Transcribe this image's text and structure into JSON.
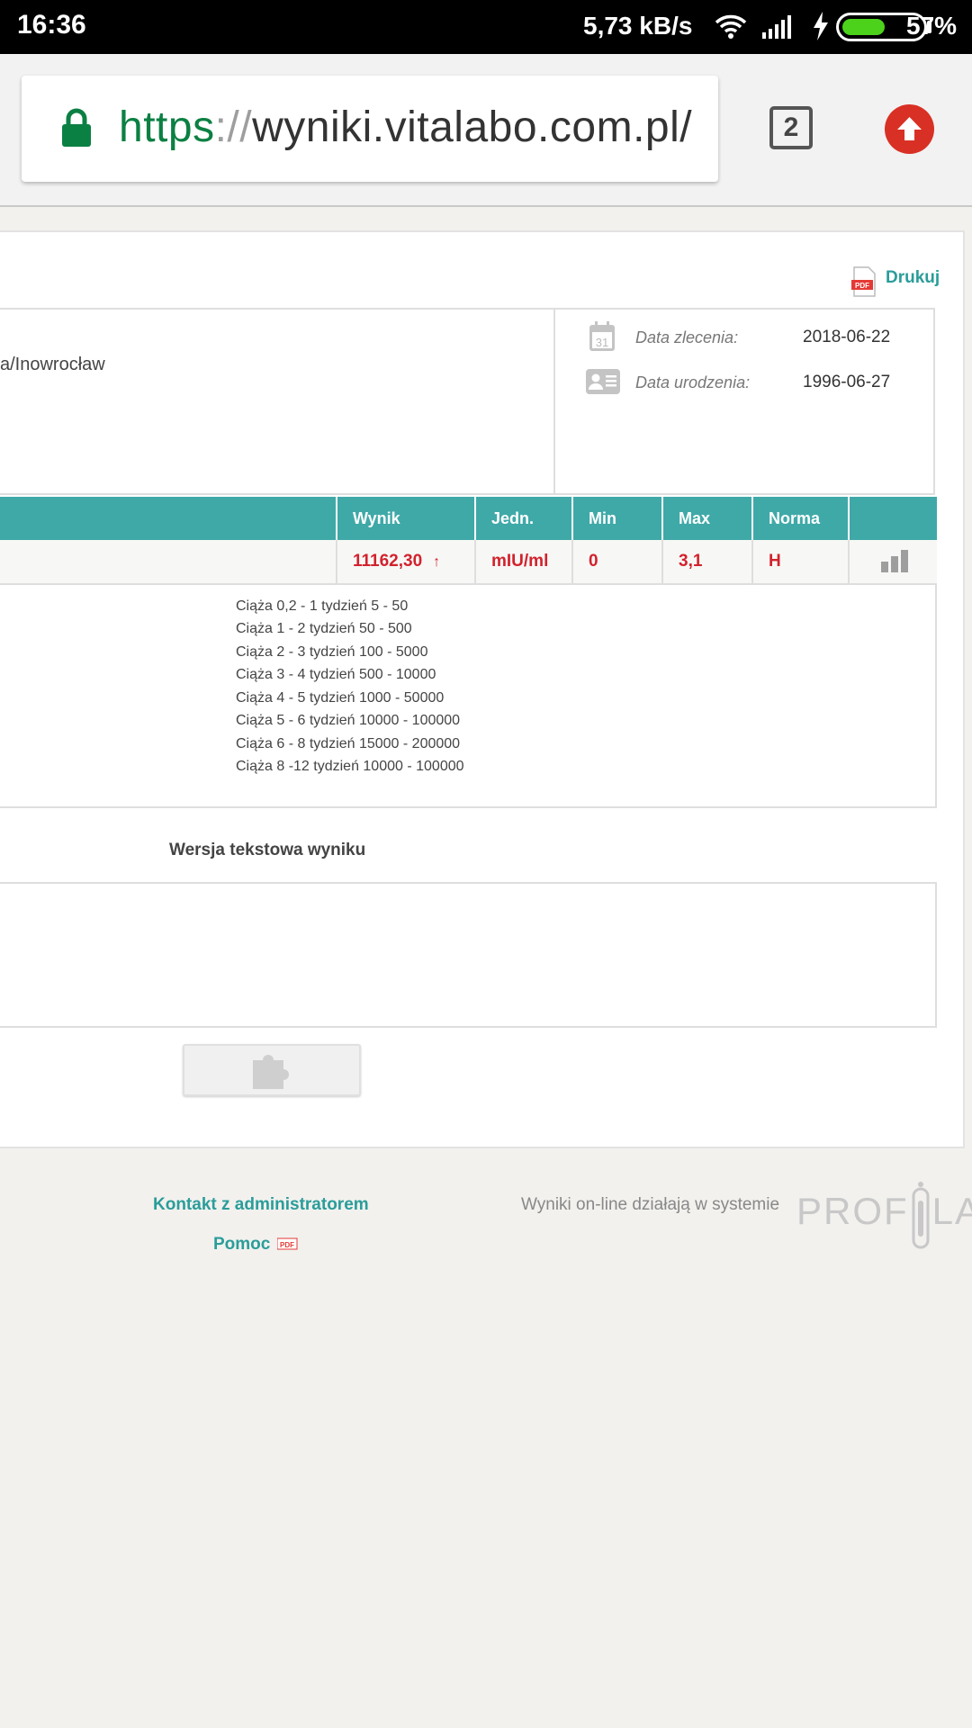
{
  "status_bar": {
    "time": "16:36",
    "network_speed": "5,73 kB/s",
    "battery_percent": "57%",
    "battery_level": 0.57,
    "icons": [
      "wifi-icon",
      "signal-icon",
      "charging-icon",
      "battery-icon"
    ]
  },
  "browser": {
    "url_scheme": "https",
    "url_separator": "://",
    "url_host": "wyniki.vitalabo.com.pl/",
    "tab_count": "2"
  },
  "page": {
    "print_label": "Drukuj",
    "patient_location": "a/Inowrocław",
    "info": [
      {
        "label": "Data zlecenia:",
        "value": "2018-06-22",
        "icon": "calendar-icon"
      },
      {
        "label": "Data urodzenia:",
        "value": "1996-06-27",
        "icon": "id-card-icon"
      }
    ],
    "table": {
      "headers": [
        "Wynik",
        "Jedn.",
        "Min",
        "Max",
        "Norma"
      ],
      "row": {
        "result": "11162,30",
        "unit": "mIU/ml",
        "min": "0",
        "max": "3,1",
        "norm": "H"
      }
    },
    "norms": [
      "Ciąża 0,2 - 1 tydzień 5 - 50",
      "Ciąża 1 - 2 tydzień 50 - 500",
      "Ciąża 2 - 3 tydzień 100 - 5000",
      "Ciąża 3 - 4 tydzień 500 - 10000",
      "Ciąża 4 - 5 tydzień 1000 - 50000",
      "Ciąża 5 - 6 tydzień 10000 - 100000",
      "Ciąża 6 - 8 tydzień 15000 - 200000",
      "Ciąża 8 -12 tydzień 10000 - 100000"
    ],
    "text_version_title": "Wersja tekstowa wyniku"
  },
  "footer": {
    "contact": "Kontakt z administratorem",
    "help": "Pomoc",
    "online_text": "Wyniki on-line działają w systemie",
    "brand_left": "PROF",
    "brand_right": "LAB"
  },
  "colors": {
    "accent": "#3fa9a8",
    "link": "#2a9d9a",
    "alert": "#d2222d"
  }
}
